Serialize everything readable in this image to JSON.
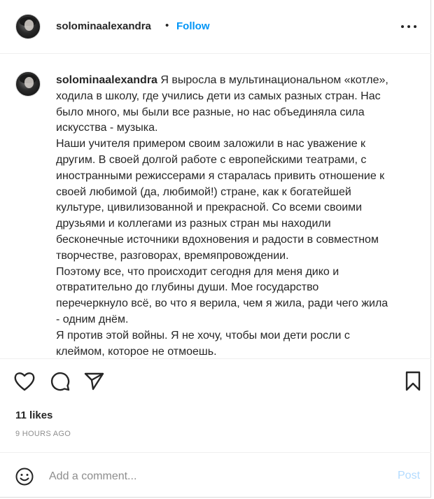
{
  "header": {
    "username": "solominaalexandra",
    "separator": "•",
    "follow_label": "Follow",
    "more_icon": "more-horizontal-icon"
  },
  "caption": {
    "username": "solominaalexandra",
    "lines": [
      "Я выросла в мультинациональном «котле»,",
      "ходила в школу, где учились дети из самых разных стран. Нас",
      "было много, мы были все разные, но нас объединяла сила",
      "искусства - музыка.",
      "Наши учителя примером своим заложили в нас уважение к",
      "другим. В своей долгой работе с европейскими театрами, с",
      "иностранными режиссерами я старалась привить отношение к",
      "своей любимой (да, любимой!) стране, как к богатейшей",
      "культуре, цивилизованной и прекрасной. Со всеми своими",
      "друзьями и коллегами из разных стран мы находили",
      "бесконечные источники вдохновения и радости в совместном",
      "творчестве, разговорах, времяпровождении.",
      "Поэтому все, что происходит сегодня для меня дико и",
      "отвратительно до глубины души. Мое государство",
      "перечеркнуло всё, во что я верила, чем я жила, ради чего жила",
      "- одним днём.",
      "Я против этой войны. Я не хочу, чтобы мои дети росли с",
      "клеймом, которое не отмоешь."
    ]
  },
  "actions": {
    "like_icon": "heart-icon",
    "comment_icon": "comment-icon",
    "share_icon": "share-icon",
    "save_icon": "bookmark-icon"
  },
  "likes_text": "11 likes",
  "timestamp": "9 HOURS AGO",
  "comment_box": {
    "emoji_icon": "emoji-icon",
    "placeholder": "Add a comment...",
    "post_label": "Post"
  },
  "colors": {
    "accent": "#0095f6",
    "post_disabled": "#b3dbff",
    "muted": "#8e8e8e",
    "text": "#262626"
  }
}
